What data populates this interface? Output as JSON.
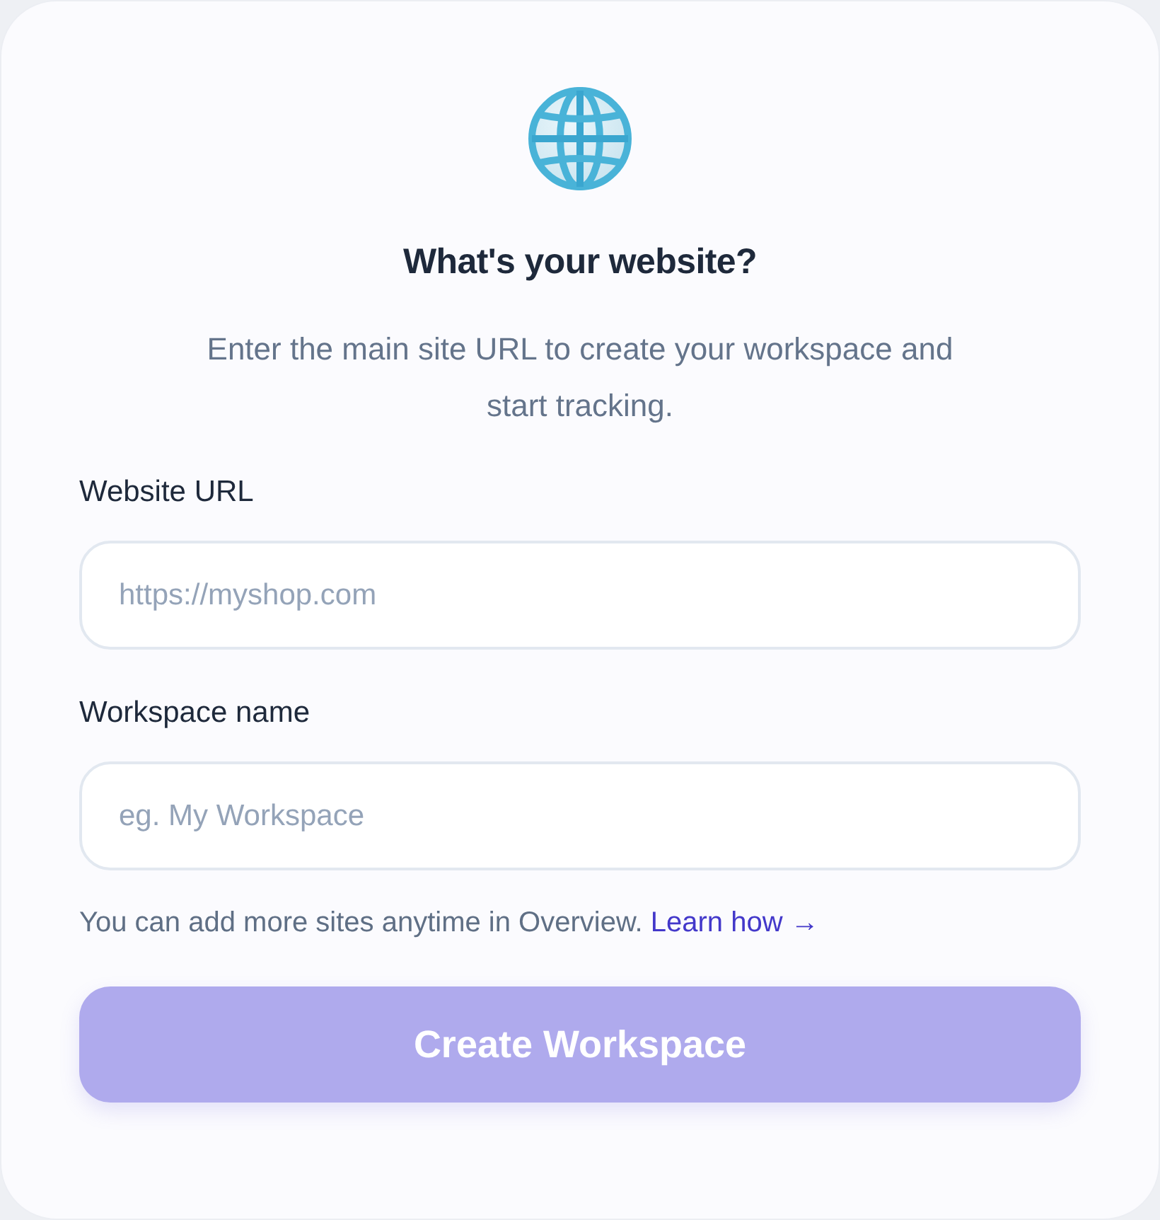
{
  "heading": "What's your website?",
  "subtitle": "Enter the main site URL to create your workspace and start tracking.",
  "fields": [
    {
      "label": "Website URL",
      "placeholder": "https://myshop.com"
    },
    {
      "label": "Workspace name",
      "placeholder": "eg. My Workspace"
    }
  ],
  "hint": {
    "text": "You can add more sites anytime in Overview.",
    "link": "Learn how →"
  },
  "submit_button": {
    "label": "Create Workspace",
    "disabled": true
  }
}
